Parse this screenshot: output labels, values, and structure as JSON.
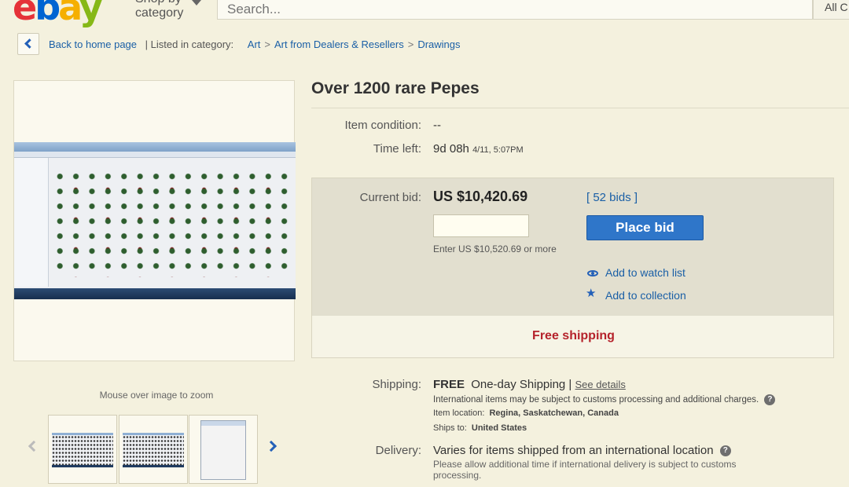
{
  "header": {
    "logo": {
      "e": "e",
      "b": "b",
      "a": "a",
      "y": "y"
    },
    "shop_by": "Shop by",
    "shop_by_2": "category",
    "search_placeholder": "Search...",
    "all_categories": "All C"
  },
  "breadcrumb": {
    "back": "Back to home page",
    "listed_in": "| Listed in category:",
    "items": [
      "Art",
      "Art from Dealers & Resellers",
      "Drawings"
    ],
    "separator": ">"
  },
  "gallery": {
    "zoom_hint": "Mouse over image to zoom"
  },
  "item": {
    "title": "Over 1200 rare Pepes",
    "condition_label": "Item condition:",
    "condition_value": "--",
    "time_left_label": "Time left:",
    "time_left_value": "9d 08h",
    "time_left_date": "4/11, 5:07PM",
    "current_bid_label": "Current bid:",
    "current_bid_value": "US $10,420.69",
    "bids": "[ 52 bids ]",
    "place_bid": "Place bid",
    "enter_hint": "Enter US $10,520.69 or more",
    "watch": "Add to watch list",
    "collection": "Add to collection",
    "free_shipping": "Free shipping"
  },
  "shipping": {
    "label": "Shipping:",
    "free": "FREE",
    "method": "One-day Shipping |",
    "see_details": "See details",
    "intl_note": "International items may be subject to customs processing and additional charges.",
    "location_label": "Item location:",
    "location_value": "Regina, Saskatchewan, Canada",
    "ships_to_label": "Ships to:",
    "ships_to_value": "United States"
  },
  "delivery": {
    "label": "Delivery:",
    "value": "Varies for items shipped from an international location",
    "note": "Please allow additional time if international delivery is subject to customs processing."
  },
  "colors": {
    "page_bg": "#f4f1de",
    "link": "#1a5fa6",
    "primary_button": "#2f76c9",
    "free_shipping": "#b5222b"
  }
}
